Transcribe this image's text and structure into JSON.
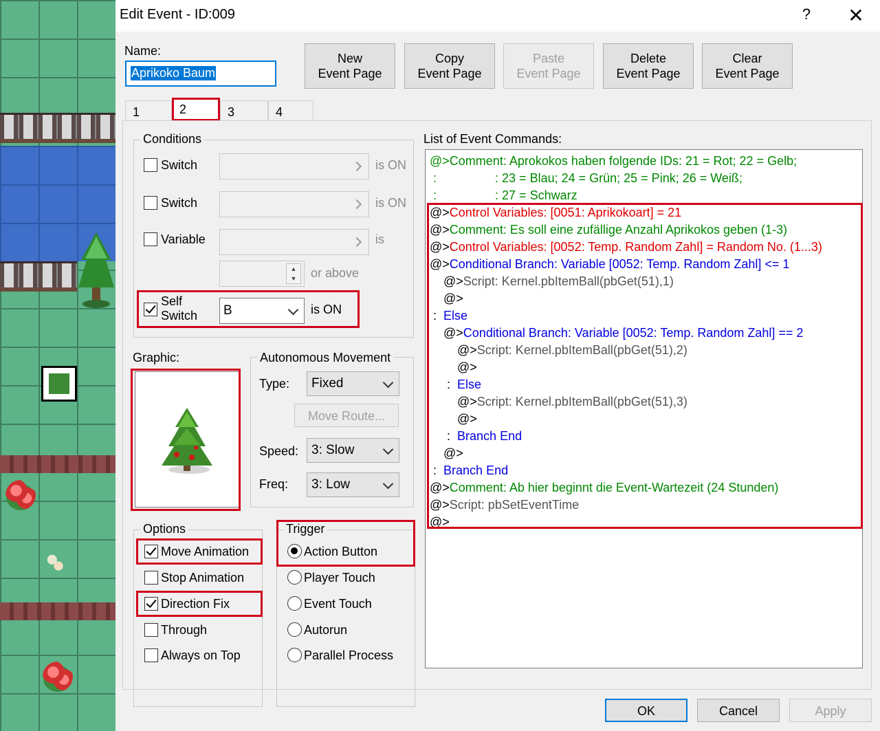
{
  "window": {
    "title": "Edit Event - ID:009",
    "help": "?",
    "close": "✕"
  },
  "name": {
    "label": "Name:",
    "value": "Aprikoko Baum"
  },
  "page_buttons": [
    {
      "line1": "New",
      "line2": "Event Page"
    },
    {
      "line1": "Copy",
      "line2": "Event Page"
    },
    {
      "line1": "Paste",
      "line2": "Event Page"
    },
    {
      "line1": "Delete",
      "line2": "Event Page"
    },
    {
      "line1": "Clear",
      "line2": "Event Page"
    }
  ],
  "tabs": [
    "1",
    "2",
    "3",
    "4"
  ],
  "conditions": {
    "title": "Conditions",
    "switch1": {
      "label": "Switch",
      "suffix": "is ON"
    },
    "switch2": {
      "label": "Switch",
      "suffix": "is ON"
    },
    "variable": {
      "label": "Variable",
      "suffix": "is",
      "suffix2": "or above"
    },
    "self_switch": {
      "line1": "Self",
      "line2": "Switch",
      "value": "B",
      "suffix": "is ON"
    }
  },
  "graphic": {
    "label": "Graphic:"
  },
  "movement": {
    "title": "Autonomous Movement",
    "type_label": "Type:",
    "type_value": "Fixed",
    "move_route": "Move Route...",
    "speed_label": "Speed:",
    "speed_value": "3: Slow",
    "freq_label": "Freq:",
    "freq_value": "3: Low"
  },
  "options": {
    "title": "Options",
    "move_animation": "Move Animation",
    "stop_animation": "Stop Animation",
    "direction_fix": "Direction Fix",
    "through": "Through",
    "always_on_top": "Always on Top"
  },
  "trigger": {
    "title": "Trigger",
    "action_button": "Action Button",
    "player_touch": "Player Touch",
    "event_touch": "Event Touch",
    "autorun": "Autorun",
    "parallel_process": "Parallel Process"
  },
  "commands": {
    "title": "List of Event Commands:",
    "lines": [
      {
        "prefix": "@>",
        "text": "Comment: Aprokokos haben folgende IDs: 21 = Rot; 22 = Gelb;"
      },
      {
        "prefix": " :",
        "text": "                 : 23 = Blau; 24 = Grün; 25 = Pink; 26 = Weiß;"
      },
      {
        "prefix": " :",
        "text": "                 : 27 = Schwarz"
      },
      {
        "prefix": "@>",
        "text": "Control Variables: [0051: Aprikokoart] = 21"
      },
      {
        "prefix": "@>",
        "text": "Comment: Es soll eine zufällige Anzahl Aprikokos geben (1-3)"
      },
      {
        "prefix": "@>",
        "text": "Control Variables: [0052: Temp. Random Zahl] = Random No. (1...3)"
      },
      {
        "prefix": "@>",
        "text": "Conditional Branch: Variable [0052: Temp. Random Zahl] <= 1"
      },
      {
        "prefix": "@>",
        "text": "Script: Kernel.pbItemBall(pbGet(51),1)"
      },
      {
        "prefix": "@>",
        "text": ""
      },
      {
        "prefix": " :",
        "text": "Else"
      },
      {
        "prefix": "@>",
        "text": "Conditional Branch: Variable [0052: Temp. Random Zahl] == 2"
      },
      {
        "prefix": "@>",
        "text": "Script: Kernel.pbItemBall(pbGet(51),2)"
      },
      {
        "prefix": "@>",
        "text": ""
      },
      {
        "prefix": " :",
        "text": "Else"
      },
      {
        "prefix": "@>",
        "text": "Script: Kernel.pbItemBall(pbGet(51),3)"
      },
      {
        "prefix": "@>",
        "text": ""
      },
      {
        "prefix": " :",
        "text": "Branch End"
      },
      {
        "prefix": "@>",
        "text": ""
      },
      {
        "prefix": " :",
        "text": "Branch End"
      },
      {
        "prefix": "@>",
        "text": "Comment: Ab hier beginnt die Event-Wartezeit (24 Stunden)"
      },
      {
        "prefix": "@>",
        "text": "Script: pbSetEventTime"
      },
      {
        "prefix": "@>",
        "text": ""
      }
    ]
  },
  "footer": {
    "ok": "OK",
    "cancel": "Cancel",
    "apply": "Apply"
  },
  "colors": {
    "comment": "#008800",
    "control": "#e00000",
    "branch": "#0000e0",
    "script": "#555555",
    "highlight": "#d0021b"
  }
}
